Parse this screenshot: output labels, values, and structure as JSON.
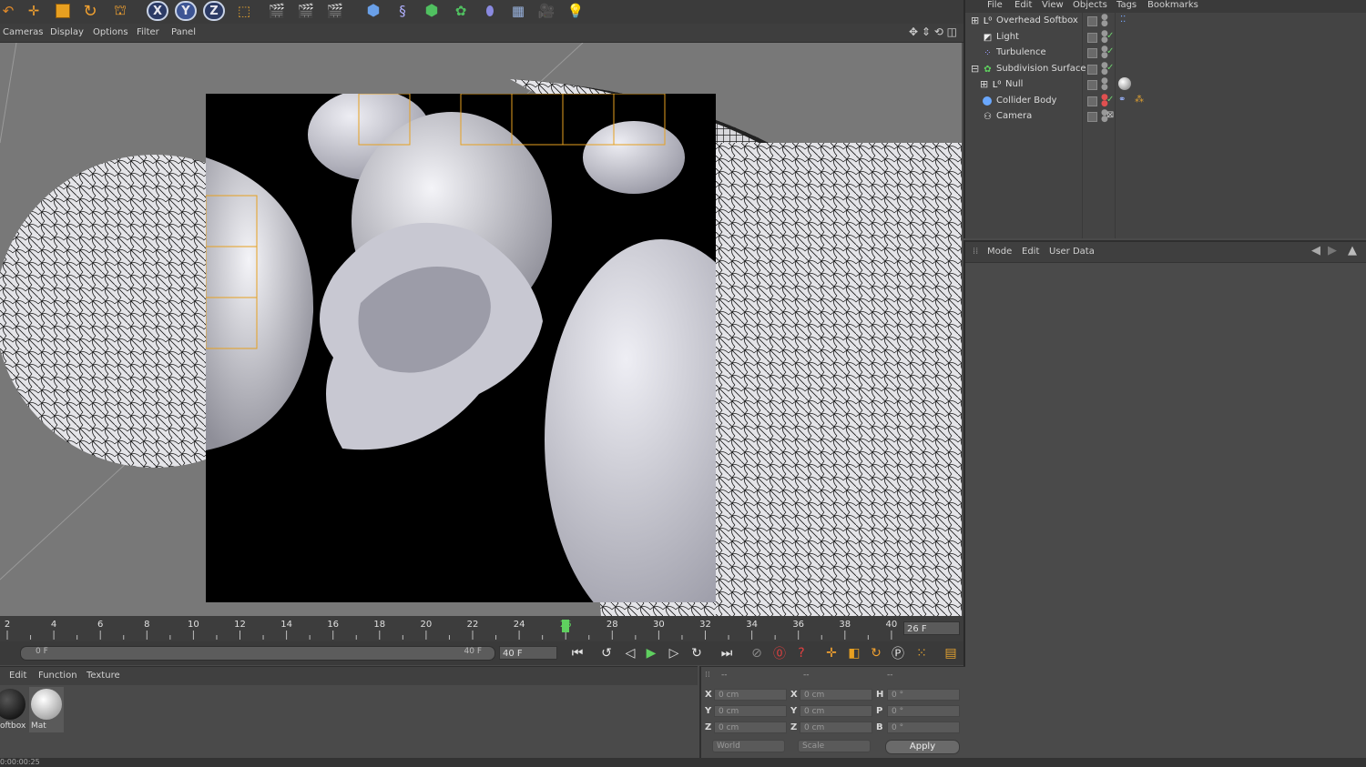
{
  "toolbar": {
    "axis_x": "X",
    "axis_y": "Y",
    "axis_z": "Z"
  },
  "viewport_menu": [
    "Cameras",
    "Display",
    "Options",
    "Filter",
    "Panel"
  ],
  "object_manager": {
    "menu": [
      "File",
      "Edit",
      "View",
      "Objects",
      "Tags",
      "Bookmarks"
    ],
    "objects": [
      {
        "name": "Overhead Softbox",
        "icon": "null-icon",
        "expand": "⊞"
      },
      {
        "name": "Light",
        "icon": "light-icon",
        "expand": ""
      },
      {
        "name": "Turbulence",
        "icon": "turbulence-icon",
        "expand": ""
      },
      {
        "name": "Subdivision Surface",
        "icon": "subdivision-icon",
        "expand": "⊟"
      },
      {
        "name": "Null",
        "icon": "null-icon",
        "expand": "⊞"
      },
      {
        "name": "Collider Body",
        "icon": "sphere-icon",
        "expand": ""
      },
      {
        "name": "Camera",
        "icon": "camera-icon",
        "expand": ""
      }
    ]
  },
  "attribute_manager": {
    "menu": [
      "Mode",
      "Edit",
      "User Data"
    ]
  },
  "timeline": {
    "ticks": [
      "2",
      "4",
      "6",
      "8",
      "10",
      "12",
      "14",
      "16",
      "18",
      "20",
      "22",
      "24",
      "26",
      "28",
      "30",
      "32",
      "34",
      "36",
      "38",
      "40"
    ],
    "current_frame": "26 F",
    "range_start": "0 F",
    "range_end": "40 F",
    "end_field": "40 F"
  },
  "material_manager": {
    "menu": [
      "Edit",
      "Function",
      "Texture"
    ],
    "materials": [
      "oftbox",
      "Mat"
    ]
  },
  "coordinates": {
    "header": [
      "--",
      "--",
      "--"
    ],
    "pos_labels": [
      "X",
      "Y",
      "Z"
    ],
    "pos_values": [
      "0 cm",
      "0 cm",
      "0 cm"
    ],
    "size_labels": [
      "X",
      "Y",
      "Z"
    ],
    "size_values": [
      "0 cm",
      "0 cm",
      "0 cm"
    ],
    "rot_labels": [
      "H",
      "P",
      "B"
    ],
    "rot_values": [
      "0 °",
      "0 °",
      "0 °"
    ],
    "mode_world": "World",
    "mode_scale": "Scale",
    "apply_label": "Apply"
  },
  "status": "0:00:00:25"
}
